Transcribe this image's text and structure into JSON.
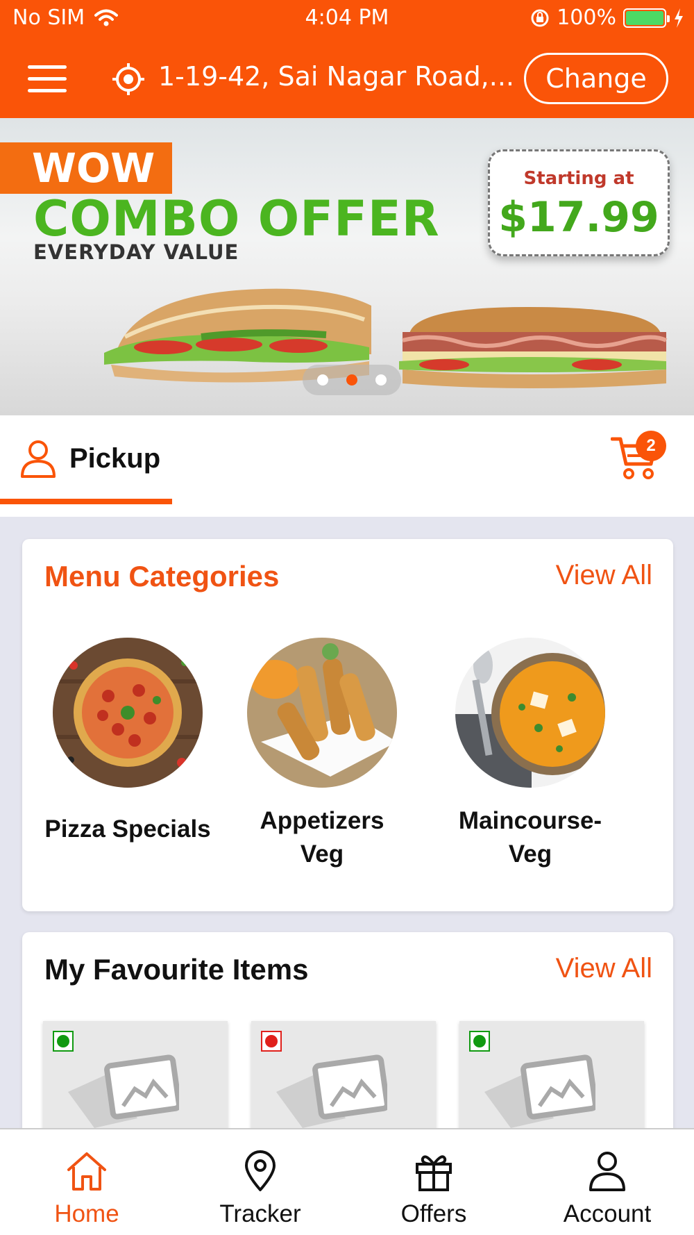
{
  "status_bar": {
    "carrier": "No SIM",
    "time": "4:04 PM",
    "battery": "100%"
  },
  "header": {
    "address": "1-19-42, Sai Nagar Road,...",
    "change_label": "Change"
  },
  "banner": {
    "badge": "WOW",
    "headline": "COMBO OFFER",
    "tagline": "EVERYDAY VALUE",
    "price_label": "Starting at",
    "price_value": "$17.99",
    "slide_count": 3,
    "active_slide": 2
  },
  "pickup": {
    "label": "Pickup",
    "cart_count": "2"
  },
  "menu_categories": {
    "title": "Menu Categories",
    "view_all": "View All",
    "items": [
      {
        "label": "Pizza Specials"
      },
      {
        "label": "Appetizers Veg"
      },
      {
        "label": "Maincourse-Veg"
      }
    ]
  },
  "favourites": {
    "title": "My Favourite Items",
    "view_all": "View All",
    "items": [
      {
        "type": "veg",
        "color": "#119a11"
      },
      {
        "type": "non-veg",
        "color": "#e0201b"
      },
      {
        "type": "veg",
        "color": "#119a11"
      }
    ]
  },
  "tabs": [
    {
      "label": "Home",
      "icon": "home-icon",
      "active": true
    },
    {
      "label": "Tracker",
      "icon": "location-pin-icon",
      "active": false
    },
    {
      "label": "Offers",
      "icon": "gift-icon",
      "active": false
    },
    {
      "label": "Account",
      "icon": "user-icon",
      "active": false
    }
  ],
  "colors": {
    "accent": "#fa5408",
    "veg": "#119a11",
    "non_veg": "#e0201b",
    "offer_green": "#4bb520"
  }
}
